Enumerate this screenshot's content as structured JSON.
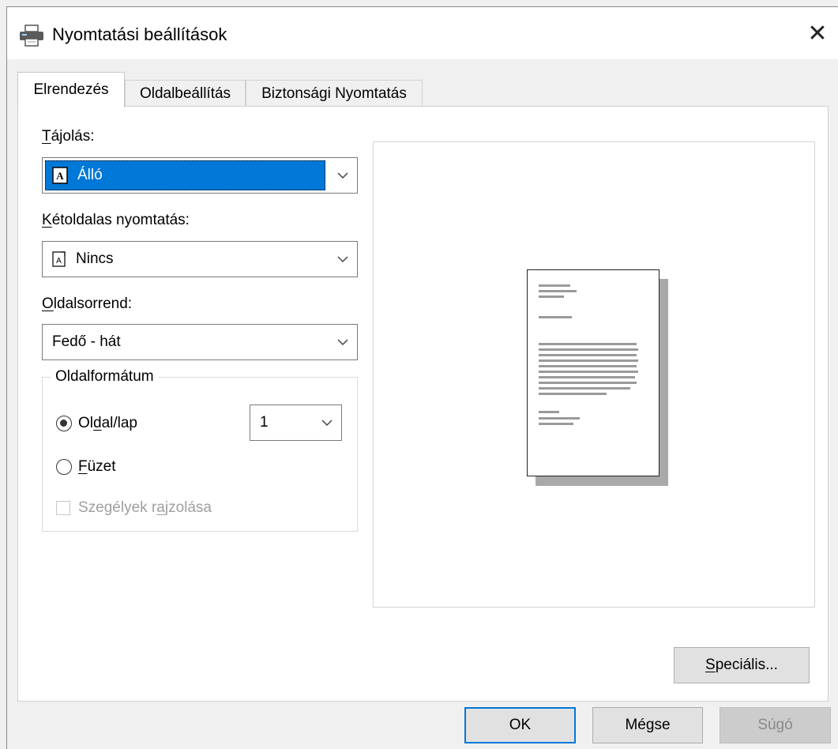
{
  "window": {
    "title": "Nyomtatási beállítások",
    "close_symbol": "✕"
  },
  "tabs": [
    {
      "label": "Elrendezés",
      "active": true
    },
    {
      "label": "Oldalbeállítás",
      "active": false
    },
    {
      "label": "Biztonsági Nyomtatás",
      "active": false
    }
  ],
  "layout": {
    "orientation": {
      "label_first": "T",
      "label_rest": "ájolás:",
      "value": "Álló",
      "icon": "portrait-page-icon"
    },
    "duplex": {
      "label_first": "K",
      "label_rest": "étoldalas nyomtatás:",
      "value": "Nincs",
      "icon": "duplex-page-icon"
    },
    "page_order": {
      "label_first": "O",
      "label_rest": "ldalsorrend:",
      "value": "Fedő - hát"
    },
    "page_format": {
      "group_title": "Oldalformátum",
      "pages_per_sheet": {
        "label_pre": "Ol",
        "label_u": "d",
        "label_post": "al/lap",
        "checked": true,
        "value": "1"
      },
      "booklet": {
        "label_u": "F",
        "label_post": "üzet",
        "checked": false
      },
      "draw_borders": {
        "label_pre": "Szegélyek r",
        "label_u": "a",
        "label_post": "jzolása",
        "checked": false,
        "enabled": false
      }
    }
  },
  "buttons": {
    "advanced": {
      "label_u": "S",
      "label_rest": "peciális..."
    },
    "ok": "OK",
    "cancel": "Mégse",
    "help": "Súgó"
  },
  "colors": {
    "accent": "#0078d7",
    "background": "#f0f0f0"
  }
}
